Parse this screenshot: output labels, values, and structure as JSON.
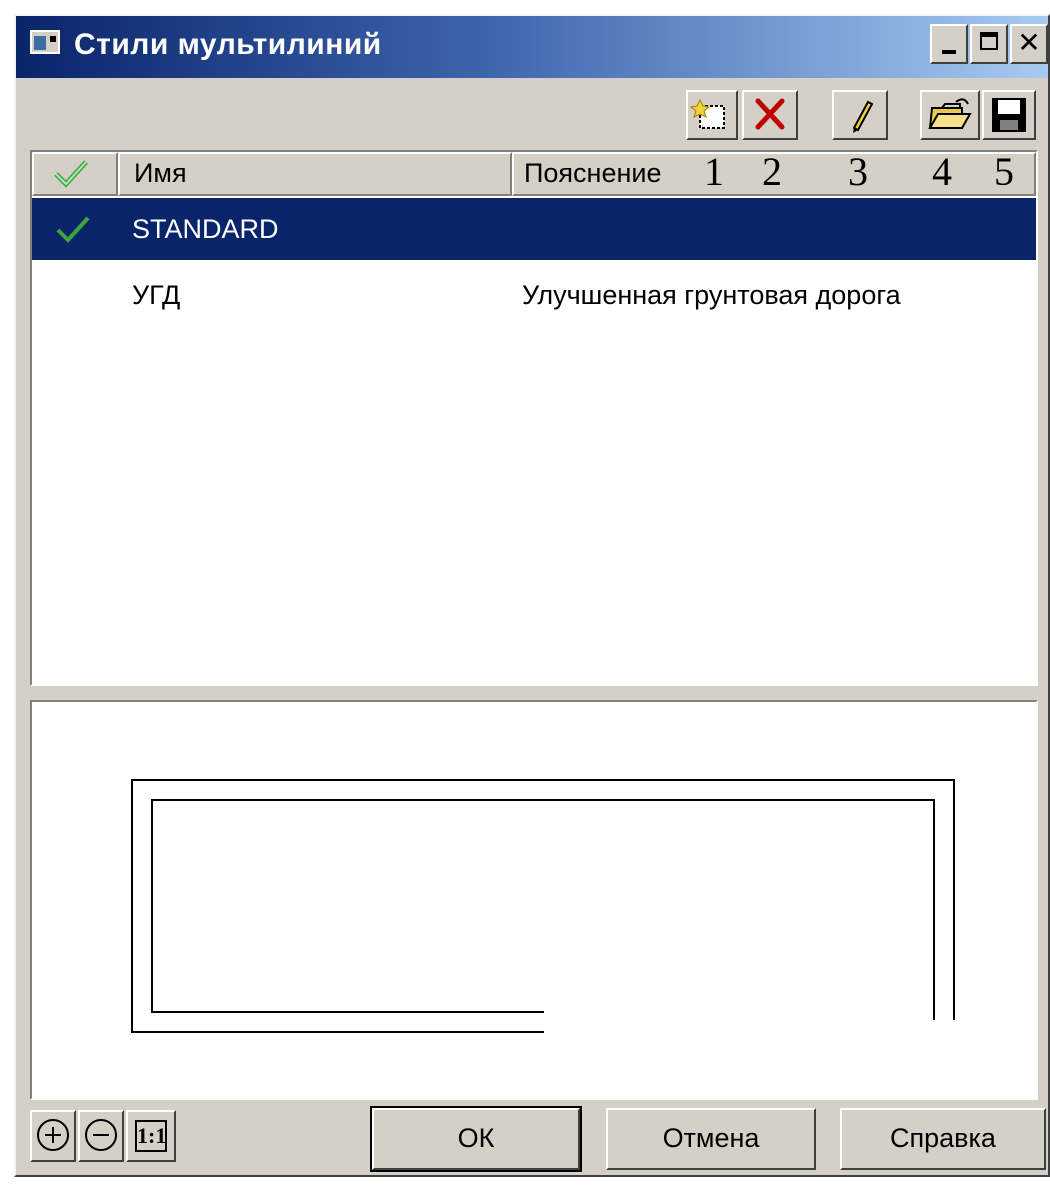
{
  "window": {
    "title": "Стили мультилиний",
    "caption_buttons": {
      "minimize": "_",
      "maximize": "□",
      "close": "✕"
    }
  },
  "toolbar": {
    "buttons": [
      {
        "icon": "new-style-icon"
      },
      {
        "icon": "delete-icon"
      },
      {
        "icon": "edit-pencil-icon"
      },
      {
        "icon": "open-folder-icon"
      },
      {
        "icon": "save-disk-icon"
      }
    ]
  },
  "list": {
    "columns": {
      "name": "Имя",
      "description": "Пояснение"
    },
    "callouts": [
      "1",
      "2",
      "3",
      "4",
      "5"
    ],
    "rows": [
      {
        "name": "STANDARD",
        "description": "",
        "active": true,
        "selected": true
      },
      {
        "name": "УГД",
        "description": "Улучшенная грунтовая дорога",
        "active": false,
        "selected": false
      }
    ]
  },
  "zoom": {
    "zoom_in": "+",
    "zoom_out": "−",
    "one_to_one": "1:1"
  },
  "buttons": {
    "ok": "ОК",
    "cancel": "Отмена",
    "help": "Справка"
  },
  "colors": {
    "selection": "#0a246a",
    "check_green": "#3aa53a",
    "delete_red": "#c00000",
    "folder_yellow": "#e8c84a"
  }
}
